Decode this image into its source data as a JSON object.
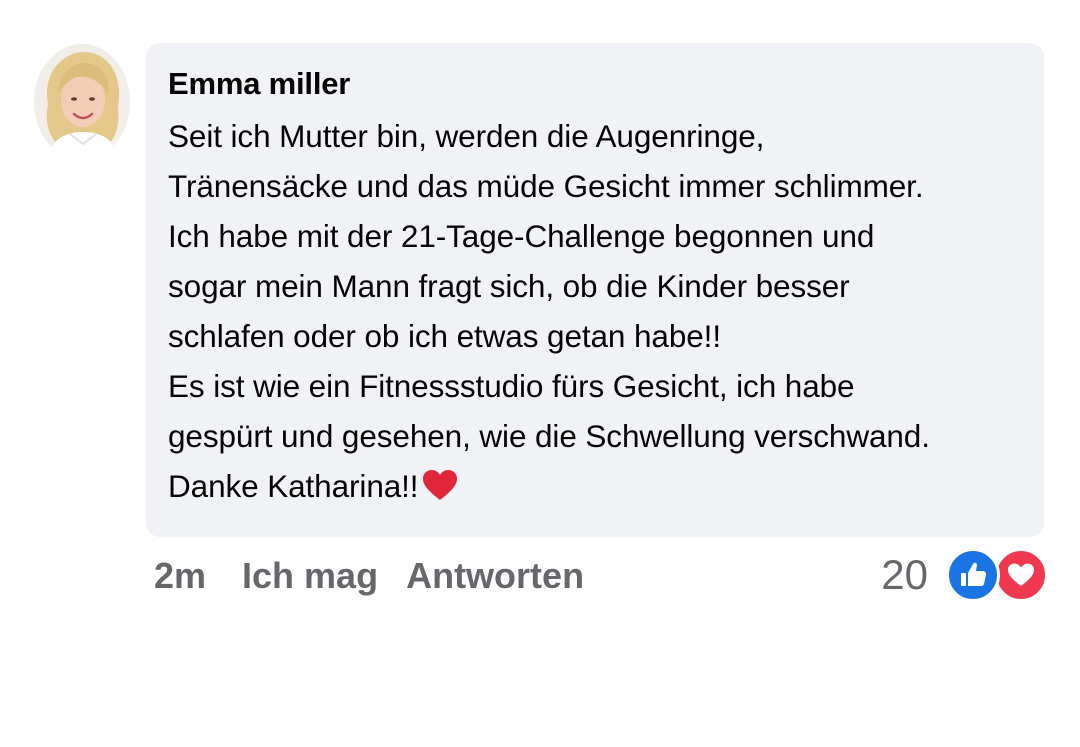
{
  "comment": {
    "author": "Emma miller",
    "lines": [
      "Seit ich Mutter bin, werden die Augenringe,",
      "Tränensäcke und das müde Gesicht immer schlimmer.",
      "Ich habe mit der 21-Tage-Challenge begonnen und",
      "sogar mein Mann fragt sich, ob die Kinder besser",
      "schlafen oder ob ich etwas getan habe!!",
      "Es ist wie ein Fitnessstudio fürs Gesicht, ich habe",
      "gespürt und gesehen, wie die Schwellung verschwand.",
      "Danke Katharina!!"
    ]
  },
  "actions": {
    "time": "2m",
    "like_label": "Ich mag",
    "reply_label": "Antworten"
  },
  "reactions": {
    "count": "20",
    "icons": [
      "like-icon",
      "love-icon"
    ]
  },
  "colors": {
    "bubble": "#f0f2f5",
    "action_text": "#65676b",
    "like_blue": "#1b74e4",
    "love_red": "#f0384f",
    "heart_emoji": "#e0263a"
  }
}
